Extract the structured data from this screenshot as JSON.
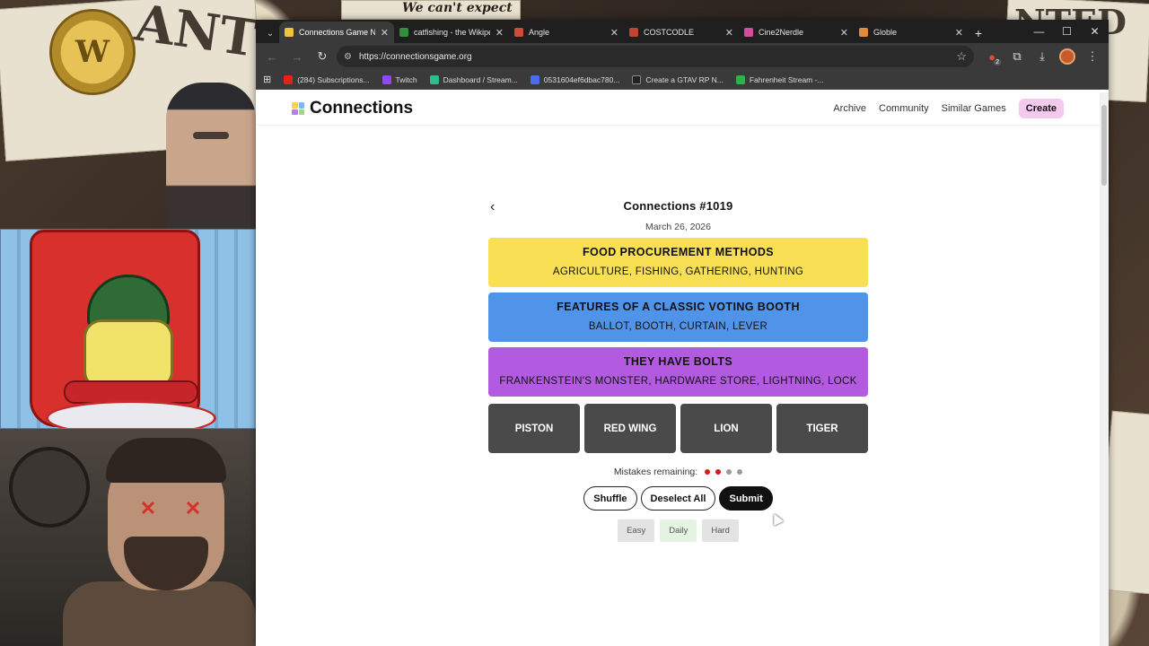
{
  "overlay": {
    "wanted_left": "ANTED",
    "wanted_right": "NTED",
    "cant_text": "We can't expect",
    "logo_letter": "W"
  },
  "browser": {
    "tabs": [
      {
        "title": "Connections Game NY",
        "favicon_color": "#f0c33c",
        "active": true
      },
      {
        "title": "catfishing - the Wikipe",
        "favicon_color": "#2f8f3a",
        "active": false
      },
      {
        "title": "Angle",
        "favicon_color": "#d04a3c",
        "active": false
      },
      {
        "title": "COSTCODLE",
        "favicon_color": "#c2432f",
        "active": false
      },
      {
        "title": "Cine2Nerdle",
        "favicon_color": "#d84b9a",
        "active": false
      },
      {
        "title": "Globle",
        "favicon_color": "#e28a3a",
        "active": false
      }
    ],
    "url": "https://connectionsgame.org",
    "bookmarks": [
      {
        "label": "(284) Subscriptions...",
        "favicon_color": "#e62117"
      },
      {
        "label": "Twitch",
        "favicon_color": "#9146ff"
      },
      {
        "label": "Dashboard / Stream...",
        "favicon_color": "#2dbe8c"
      },
      {
        "label": "0531604ef6dbac780...",
        "favicon_color": "#4a6cf0"
      },
      {
        "label": "Create a GTAV RP N...",
        "favicon_color": "#222222"
      },
      {
        "label": "Fahrenheit Stream -...",
        "favicon_color": "#29b34a"
      }
    ],
    "extension_badge": "2"
  },
  "site": {
    "brand": "Connections",
    "logo_colors": [
      "#f5d547",
      "#7cb7f0",
      "#b97ee6",
      "#9fd68a"
    ],
    "nav": {
      "archive": "Archive",
      "community": "Community",
      "similar": "Similar Games",
      "create": "Create"
    }
  },
  "game": {
    "title": "Connections #1019",
    "date": "March 26, 2026",
    "solved": [
      {
        "category": "FOOD PROCUREMENT METHODS",
        "words": "AGRICULTURE, FISHING, GATHERING, HUNTING",
        "color": "#f9df54"
      },
      {
        "category": "FEATURES OF A CLASSIC VOTING BOOTH",
        "words": "BALLOT, BOOTH, CURTAIN, LEVER",
        "color": "#4f94e8"
      },
      {
        "category": "THEY HAVE BOLTS",
        "words": "FRANKENSTEIN'S MONSTER, HARDWARE STORE, LIGHTNING, LOCK",
        "color": "#b25be0"
      }
    ],
    "tiles": [
      "PISTON",
      "RED WING",
      "LION",
      "TIGER"
    ],
    "mistakes_label": "Mistakes remaining:",
    "mistake_dots": [
      "#d81b1b",
      "#d81b1b",
      "#9a9a9a",
      "#9a9a9a"
    ],
    "buttons": {
      "shuffle": "Shuffle",
      "deselect": "Deselect All",
      "submit": "Submit"
    },
    "modes": [
      {
        "label": "Easy",
        "bg": "#e3e3e3"
      },
      {
        "label": "Daily",
        "bg": "#e4f3e2"
      },
      {
        "label": "Hard",
        "bg": "#e3e3e3"
      }
    ]
  }
}
